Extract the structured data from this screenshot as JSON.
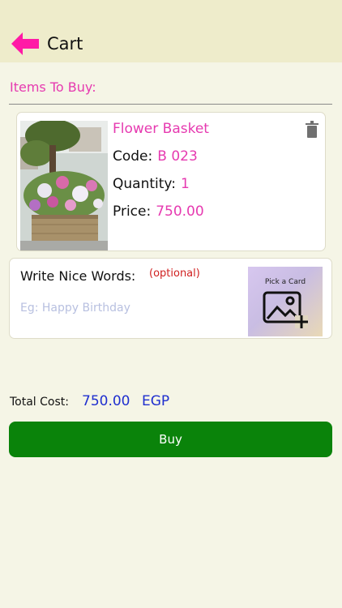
{
  "header": {
    "title": "Cart",
    "back_icon": "back-arrow-icon",
    "accent": "#ff1aa6"
  },
  "section": {
    "title": "Items To Buy:"
  },
  "item": {
    "name": "Flower Basket",
    "code_label": "Code:",
    "code_value": "B 023",
    "quantity_label": "Quantity:",
    "quantity_value": "1",
    "price_label": "Price:",
    "price_value": "750.00",
    "delete_icon": "trash-icon"
  },
  "note": {
    "label": "Write Nice Words:",
    "optional": "(optional)",
    "placeholder": "Eg: Happy Birthday",
    "value": "",
    "card_picker_label": "Pick a Card",
    "card_picker_icon": "add-image-icon"
  },
  "total": {
    "label": "Total Cost:",
    "value": "750.00",
    "currency": "EGP"
  },
  "buy": {
    "label": "Buy"
  },
  "colors": {
    "header_bg": "#eeeccb",
    "page_bg": "#f5f5e6",
    "pink": "#e63ab0",
    "blue": "#1f2fcf",
    "buy_green": "#0a830a",
    "optional_red": "#d02020"
  }
}
